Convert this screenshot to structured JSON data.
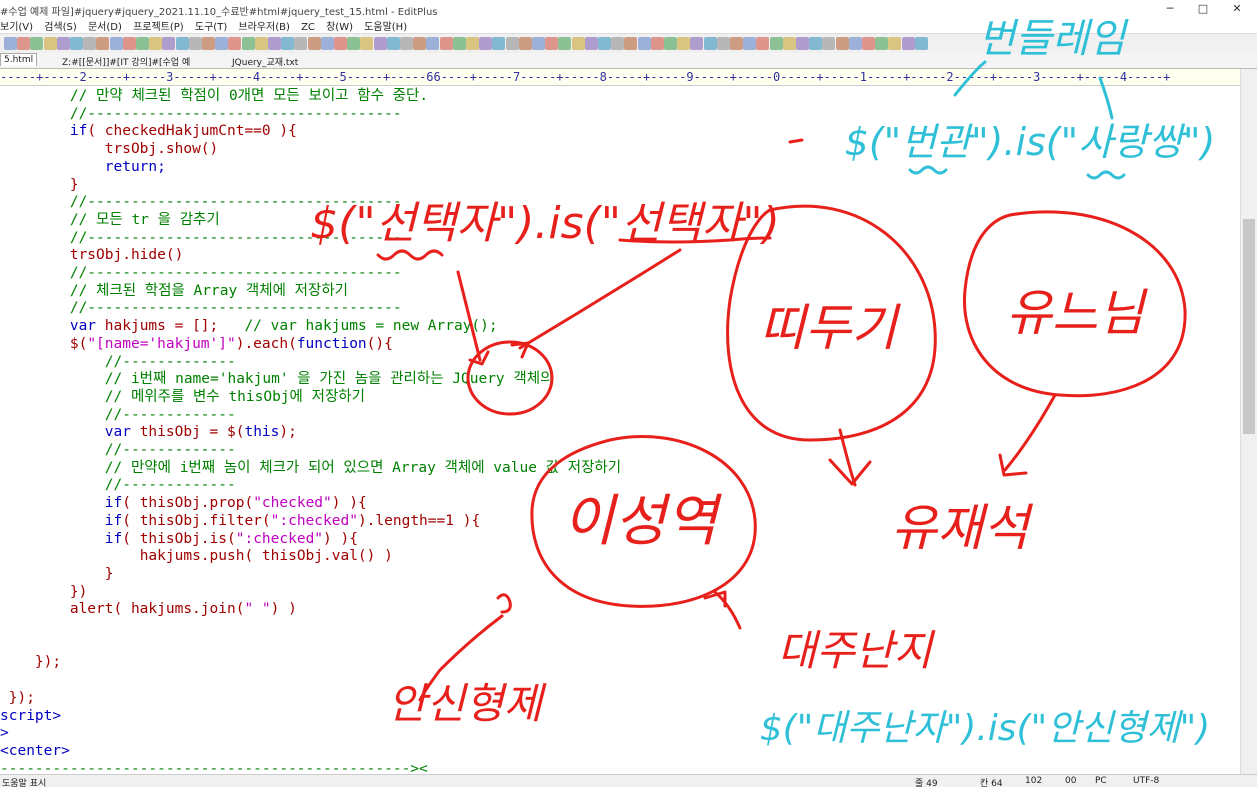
{
  "window": {
    "title": "#수업 예제 파일]#jquery#jquery_2021.11.10_수료반#html#jquery_test_15.html - EditPlus",
    "minimize": "─",
    "maximize": "□",
    "close": "✕"
  },
  "menu": [
    "보기(V)",
    "검색(S)",
    "문서(D)",
    "프로젝트(P)",
    "도구(T)",
    "브라우저(B)",
    "ZC",
    "창(W)",
    "도움말(H)"
  ],
  "tabs": [
    "5.html",
    "Z:#[[문서]]#[IT 강의]#[수업 예",
    "JQuery_교재.txt"
  ],
  "ruler": "-----+-----2-----+-----3-----+-----4-----+-----5-----+-----66----+-----7-----+-----8-----+-----9-----+-----0-----+-----1-----+-----2-----+-----3-----+-----4-----+",
  "code": [
    {
      "indent": "        ",
      "parts": [
        {
          "t": "// 만약 체크된 학점이 0개면 모든 보이고 함수 중단.",
          "c": "c-com"
        }
      ]
    },
    {
      "indent": "        ",
      "parts": [
        {
          "t": "//------------------------------------",
          "c": "c-com"
        }
      ]
    },
    {
      "indent": "        ",
      "parts": [
        {
          "t": "if",
          "c": "c-kw"
        },
        {
          "t": "( checkedHakjumCnt==0 ){",
          "c": ""
        }
      ]
    },
    {
      "indent": "            ",
      "parts": [
        {
          "t": "trsObj.show()",
          "c": ""
        }
      ]
    },
    {
      "indent": "            ",
      "parts": [
        {
          "t": "return;",
          "c": "c-kw"
        }
      ]
    },
    {
      "indent": "        ",
      "parts": [
        {
          "t": "}",
          "c": ""
        }
      ]
    },
    {
      "indent": "        ",
      "parts": [
        {
          "t": "//------------------------------------",
          "c": "c-com"
        }
      ]
    },
    {
      "indent": "        ",
      "parts": [
        {
          "t": "// 모든 tr 을 감추기",
          "c": "c-com"
        }
      ]
    },
    {
      "indent": "        ",
      "parts": [
        {
          "t": "//------------------------------------",
          "c": "c-com"
        }
      ]
    },
    {
      "indent": "        ",
      "parts": [
        {
          "t": "trsObj.hide()",
          "c": ""
        }
      ]
    },
    {
      "indent": "        ",
      "parts": [
        {
          "t": "//------------------------------------",
          "c": "c-com"
        }
      ]
    },
    {
      "indent": "        ",
      "parts": [
        {
          "t": "// 체크된 학점을 Array 객체에 저장하기",
          "c": "c-com"
        }
      ]
    },
    {
      "indent": "        ",
      "parts": [
        {
          "t": "//------------------------------------",
          "c": "c-com"
        }
      ]
    },
    {
      "indent": "        ",
      "parts": [
        {
          "t": "var",
          "c": "c-kw"
        },
        {
          "t": " hakjums = [];   ",
          "c": ""
        },
        {
          "t": "// var hakjums = new Array();",
          "c": "c-com"
        }
      ]
    },
    {
      "indent": "        ",
      "parts": [
        {
          "t": "$(",
          "c": ""
        },
        {
          "t": "\"[name='hakjum']\"",
          "c": "c-str"
        },
        {
          "t": ").each(",
          "c": ""
        },
        {
          "t": "function",
          "c": "c-kw"
        },
        {
          "t": "(){",
          "c": ""
        }
      ]
    },
    {
      "indent": "            ",
      "parts": [
        {
          "t": "//-------------",
          "c": "c-com"
        }
      ]
    },
    {
      "indent": "            ",
      "parts": [
        {
          "t": "// i번째 name='hakjum' 을 가진 놈을 관리하는 JQuery 객체의",
          "c": "c-com"
        }
      ]
    },
    {
      "indent": "            ",
      "parts": [
        {
          "t": "// 메위주를 변수 thisObj에 저장하기",
          "c": "c-com"
        }
      ]
    },
    {
      "indent": "            ",
      "parts": [
        {
          "t": "//-------------",
          "c": "c-com"
        }
      ]
    },
    {
      "indent": "            ",
      "parts": [
        {
          "t": "var",
          "c": "c-kw"
        },
        {
          "t": " thisObj = $(",
          "c": ""
        },
        {
          "t": "this",
          "c": "c-kw"
        },
        {
          "t": ");",
          "c": ""
        }
      ]
    },
    {
      "indent": "            ",
      "parts": [
        {
          "t": "//-------------",
          "c": "c-com"
        }
      ]
    },
    {
      "indent": "            ",
      "parts": [
        {
          "t": "// 만약에 i번째 놈이 체크가 되어 있으면 Array 객체에 value 값 저장하기",
          "c": "c-com"
        }
      ]
    },
    {
      "indent": "            ",
      "parts": [
        {
          "t": "//-------------",
          "c": "c-com"
        }
      ]
    },
    {
      "indent": "            ",
      "parts": [
        {
          "t": "if",
          "c": "c-kw"
        },
        {
          "t": "( thisObj.prop(",
          "c": ""
        },
        {
          "t": "\"checked\"",
          "c": "c-str"
        },
        {
          "t": ") ){",
          "c": ""
        }
      ]
    },
    {
      "indent": "            ",
      "parts": [
        {
          "t": "if",
          "c": "c-kw"
        },
        {
          "t": "( thisObj.filter(",
          "c": ""
        },
        {
          "t": "\":checked\"",
          "c": "c-str"
        },
        {
          "t": ").length==1 ){",
          "c": ""
        }
      ]
    },
    {
      "indent": "            ",
      "parts": [
        {
          "t": "if",
          "c": "c-kw"
        },
        {
          "t": "( thisObj.is(",
          "c": ""
        },
        {
          "t": "\":checked\"",
          "c": "c-str"
        },
        {
          "t": ") ){",
          "c": ""
        }
      ]
    },
    {
      "indent": "                ",
      "parts": [
        {
          "t": "hakjums.push( thisObj.val() )",
          "c": ""
        }
      ]
    },
    {
      "indent": "            ",
      "parts": [
        {
          "t": "}",
          "c": ""
        }
      ]
    },
    {
      "indent": "        ",
      "parts": [
        {
          "t": "})",
          "c": ""
        }
      ]
    },
    {
      "indent": "        ",
      "parts": [
        {
          "t": "alert( hakjums.join(",
          "c": ""
        },
        {
          "t": "\" \"",
          "c": "c-str"
        },
        {
          "t": ") )",
          "c": ""
        }
      ]
    },
    {
      "indent": "",
      "parts": [
        {
          "t": "",
          "c": ""
        }
      ]
    },
    {
      "indent": "",
      "parts": [
        {
          "t": "",
          "c": ""
        }
      ]
    },
    {
      "indent": "    ",
      "parts": [
        {
          "t": "});",
          "c": ""
        }
      ]
    },
    {
      "indent": "",
      "parts": [
        {
          "t": "",
          "c": ""
        }
      ]
    },
    {
      "indent": " ",
      "parts": [
        {
          "t": "});",
          "c": ""
        }
      ]
    },
    {
      "indent": "",
      "parts": [
        {
          "t": "script>",
          "c": "c-tag"
        }
      ]
    },
    {
      "indent": "",
      "parts": [
        {
          "t": ">",
          "c": "c-tag"
        }
      ]
    },
    {
      "indent": "",
      "parts": [
        {
          "t": "<center>",
          "c": "c-tag"
        }
      ]
    },
    {
      "indent": "",
      "parts": [
        {
          "t": "-----------------------------------------------><",
          "c": "c-com"
        }
      ]
    }
  ],
  "annotations": {
    "top_right": "번들레임",
    "top_right_expr_1": "$(\"번관\").is(\"사랑쌍\")",
    "middle_expr": "$(\"선택자\").is(\"선택자\")",
    "bubble_1": "띠두기",
    "bubble_2": "유느님",
    "bubble_3": "이성역",
    "label_yujaeseok": "유재석",
    "label_daejunan": "대주난지",
    "label_ansinhyeong": "안신형제",
    "bottom_expr": "$(\"대주난자\").is(\"안신형제\")"
  },
  "status": {
    "left": "도움말 표시",
    "line": "줄 49",
    "col": "칸 64",
    "num1": "102",
    "num2": "00",
    "mode": "PC",
    "encoding": "UTF-8"
  },
  "colors": {
    "ink_red": "#e8201c",
    "ink_cyan": "#2fc0d8"
  }
}
